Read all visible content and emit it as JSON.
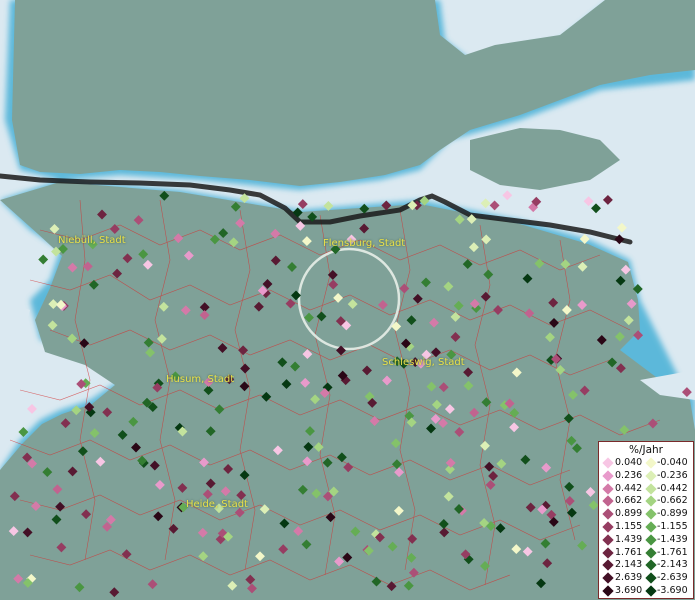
{
  "legend": {
    "title": "%/Jahr",
    "positive": [
      "0.040",
      "0.236",
      "0.442",
      "0.662",
      "0.899",
      "1.155",
      "1.439",
      "1.761",
      "2.143",
      "2.639",
      "3.690"
    ],
    "negative": [
      "-0.040",
      "-0.236",
      "-0.442",
      "-0.662",
      "-0.899",
      "-1.155",
      "-1.439",
      "-1.761",
      "-2.143",
      "-2.639",
      "-3.690"
    ],
    "positive_colors": [
      "#f7c6e4",
      "#e89acb",
      "#d47aa8",
      "#c1638f",
      "#ab4f77",
      "#963d62",
      "#823050",
      "#6d2440",
      "#581a33",
      "#431026",
      "#2a0716"
    ],
    "negative_colors": [
      "#f3f7c9",
      "#dcefb6",
      "#c3e39d",
      "#a4d482",
      "#84c26a",
      "#65ad55",
      "#4a9642",
      "#347e33",
      "#216626",
      "#114f1b",
      "#053812"
    ]
  },
  "places": {
    "niebuell": "Niebüll, Stadt",
    "flensburg": "Flensburg, Stadt",
    "schleswig": "Schleswig, Stadt",
    "husum": "Husum, Stadt",
    "heide": "Heide, Stadt"
  },
  "colors": {
    "sea": "#dbe9f1",
    "land": "#7fa198",
    "coast": "#4fb3d8",
    "border": "#1a1a1a",
    "municipality_lines": "#d43030",
    "label": "#e8e04a"
  }
}
